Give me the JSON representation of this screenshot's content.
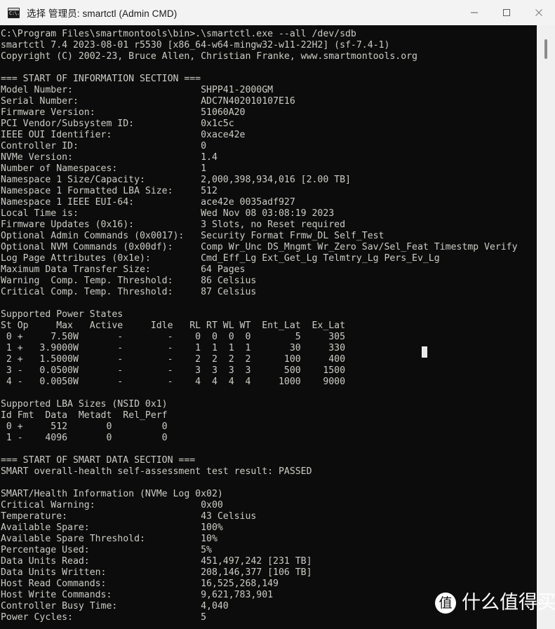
{
  "window": {
    "title_prefix": "选择",
    "title": "选择 管理员: smartctl (Admin CMD)",
    "icon_label": "C:\\.",
    "minimize_label": "最小化",
    "maximize_label": "最大化",
    "close_label": "关闭",
    "background": "#0c0c0c",
    "foreground": "#ccccc6",
    "titlebar_background": "#f3f3f3"
  },
  "watermark": {
    "badge": "值",
    "text": "什么值得买"
  },
  "terminal": {
    "prompt_line": "C:\\Program Files\\smartmontools\\bin>.\\smartctl.exe --all /dev/sdb",
    "lines": [
      "C:\\Program Files\\smartmontools\\bin>.\\smartctl.exe --all /dev/sdb",
      "smartctl 7.4 2023-08-01 r5530 [x86_64-w64-mingw32-w11-22H2] (sf-7.4-1)",
      "Copyright (C) 2002-23, Bruce Allen, Christian Franke, www.smartmontools.org",
      "",
      "=== START OF INFORMATION SECTION ===",
      "Model Number:                       SHPP41-2000GM",
      "Serial Number:                      ADC7N402010107E16",
      "Firmware Version:                   51060A20",
      "PCI Vendor/Subsystem ID:            0x1c5c",
      "IEEE OUI Identifier:                0xace42e",
      "Controller ID:                      0",
      "NVMe Version:                       1.4",
      "Number of Namespaces:               1",
      "Namespace 1 Size/Capacity:          2,000,398,934,016 [2.00 TB]",
      "Namespace 1 Formatted LBA Size:     512",
      "Namespace 1 IEEE EUI-64:            ace42e 0035adf927",
      "Local Time is:                      Wed Nov 08 03:08:19 2023",
      "Firmware Updates (0x16):            3 Slots, no Reset required",
      "Optional Admin Commands (0x0017):   Security Format Frmw_DL Self_Test",
      "Optional NVM Commands (0x00df):     Comp Wr_Unc DS_Mngmt Wr_Zero Sav/Sel_Feat Timestmp Verify",
      "Log Page Attributes (0x1e):         Cmd_Eff_Lg Ext_Get_Lg Telmtry_Lg Pers_Ev_Lg",
      "Maximum Data Transfer Size:         64 Pages",
      "Warning  Comp. Temp. Threshold:     86 Celsius",
      "Critical Comp. Temp. Threshold:     87 Celsius",
      "",
      "Supported Power States",
      "St Op     Max   Active     Idle   RL RT WL WT  Ent_Lat  Ex_Lat",
      " 0 +     7.50W       -        -    0  0  0  0        5     305",
      " 1 +   3.9000W       -        -    1  1  1  1       30     330",
      " 2 +   1.5000W       -        -    2  2  2  2      100     400",
      " 3 -   0.0500W       -        -    3  3  3  3      500    1500",
      " 4 -   0.0050W       -        -    4  4  4  4     1000    9000",
      "",
      "Supported LBA Sizes (NSID 0x1)",
      "Id Fmt  Data  Metadt  Rel_Perf",
      " 0 +     512       0         0",
      " 1 -    4096       0         0",
      "",
      "=== START OF SMART DATA SECTION ===",
      "SMART overall-health self-assessment test result: PASSED",
      "",
      "SMART/Health Information (NVMe Log 0x02)",
      "Critical Warning:                   0x00",
      "Temperature:                        43 Celsius",
      "Available Spare:                    100%",
      "Available Spare Threshold:          10%",
      "Percentage Used:                    5%",
      "Data Units Read:                    451,497,242 [231 TB]",
      "Data Units Written:                 208,146,377 [106 TB]",
      "Host Read Commands:                 16,525,268,149",
      "Host Write Commands:                9,621,783,901",
      "Controller Busy Time:               4,040",
      "Power Cycles:                       5"
    ],
    "device_info": {
      "Model Number": "SHPP41-2000GM",
      "Serial Number": "ADC7N402010107E16",
      "Firmware Version": "51060A20",
      "PCI Vendor/Subsystem ID": "0x1c5c",
      "IEEE OUI Identifier": "0xace42e",
      "Controller ID": "0",
      "NVMe Version": "1.4",
      "Number of Namespaces": "1",
      "Namespace 1 Size/Capacity": "2,000,398,934,016 [2.00 TB]",
      "Namespace 1 Formatted LBA Size": "512",
      "Namespace 1 IEEE EUI-64": "ace42e 0035adf927",
      "Local Time is": "Wed Nov 08 03:08:19 2023",
      "Firmware Updates (0x16)": "3 Slots, no Reset required",
      "Optional Admin Commands (0x0017)": "Security Format Frmw_DL Self_Test",
      "Optional NVM Commands (0x00df)": "Comp Wr_Unc DS_Mngmt Wr_Zero Sav/Sel_Feat Timestmp Verify",
      "Log Page Attributes (0x1e)": "Cmd_Eff_Lg Ext_Get_Lg Telmtry_Lg Pers_Ev_Lg",
      "Maximum Data Transfer Size": "64 Pages",
      "Warning  Comp. Temp. Threshold": "86 Celsius",
      "Critical Comp. Temp. Threshold": "87 Celsius"
    },
    "power_states": {
      "title": "Supported Power States",
      "columns": [
        "St",
        "Op",
        "Max",
        "Active",
        "Idle",
        "RL",
        "RT",
        "WL",
        "WT",
        "Ent_Lat",
        "Ex_Lat"
      ],
      "rows": [
        [
          "0",
          "+",
          "7.50W",
          "-",
          "-",
          "0",
          "0",
          "0",
          "0",
          "5",
          "305"
        ],
        [
          "1",
          "+",
          "3.9000W",
          "-",
          "-",
          "1",
          "1",
          "1",
          "1",
          "30",
          "330"
        ],
        [
          "2",
          "+",
          "1.5000W",
          "-",
          "-",
          "2",
          "2",
          "2",
          "2",
          "100",
          "400"
        ],
        [
          "3",
          "-",
          "0.0500W",
          "-",
          "-",
          "3",
          "3",
          "3",
          "3",
          "500",
          "1500"
        ],
        [
          "4",
          "-",
          "0.0050W",
          "-",
          "-",
          "4",
          "4",
          "4",
          "4",
          "1000",
          "9000"
        ]
      ]
    },
    "lba_sizes": {
      "title": "Supported LBA Sizes (NSID 0x1)",
      "columns": [
        "Id",
        "Fmt",
        "Data",
        "Metadt",
        "Rel_Perf"
      ],
      "rows": [
        [
          "0",
          "+",
          "512",
          "0",
          "0"
        ],
        [
          "1",
          "-",
          "4096",
          "0",
          "0"
        ]
      ]
    },
    "smart_health": {
      "section_title": "=== START OF SMART DATA SECTION ===",
      "overall_health_label": "SMART overall-health self-assessment test result:",
      "overall_health_result": "PASSED",
      "log_title": "SMART/Health Information (NVMe Log 0x02)",
      "Critical Warning": "0x00",
      "Temperature": "43 Celsius",
      "Available Spare": "100%",
      "Available Spare Threshold": "10%",
      "Percentage Used": "5%",
      "Data Units Read": "451,497,242 [231 TB]",
      "Data Units Written": "208,146,377 [106 TB]",
      "Host Read Commands": "16,525,268,149",
      "Host Write Commands": "9,621,783,901",
      "Controller Busy Time": "4,040",
      "Power Cycles": "5"
    }
  }
}
